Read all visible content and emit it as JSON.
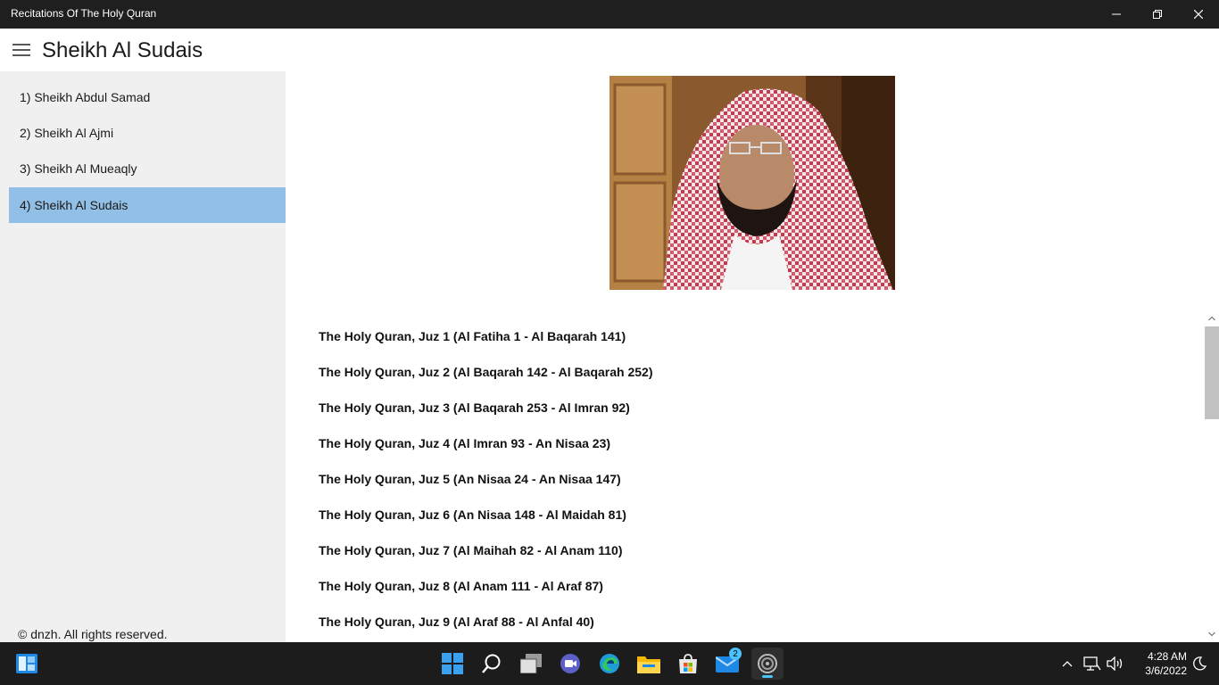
{
  "window": {
    "title": "Recitations Of The Holy Quran"
  },
  "header": {
    "page_title": "Sheikh Al Sudais"
  },
  "sidebar": {
    "items": [
      {
        "label": "1) Sheikh Abdul Samad"
      },
      {
        "label": "2) Sheikh Al Ajmi"
      },
      {
        "label": "3) Sheikh Al Mueaqly"
      },
      {
        "label": "4) Sheikh Al Sudais",
        "selected": true
      }
    ],
    "copyright": "© dnzh. All rights reserved."
  },
  "main": {
    "juz_items": [
      "The Holy Quran, Juz 1 (Al Fatiha 1 - Al Baqarah 141)",
      "The Holy Quran, Juz 2 (Al Baqarah 142 - Al Baqarah 252)",
      "The Holy Quran, Juz 3 (Al Baqarah 253 - Al Imran 92)",
      "The Holy Quran, Juz 4 (Al Imran 93 - An Nisaa 23)",
      "The Holy Quran, Juz 5 (An Nisaa 24 - An Nisaa 147)",
      "The Holy Quran, Juz 6 (An Nisaa 148 - Al Maidah 81)",
      "The Holy Quran, Juz 7 (Al Maihah 82 - Al Anam 110)",
      "The Holy Quran, Juz 8 (Al Anam 111 - Al Araf 87)",
      "The Holy Quran, Juz 9 (Al Araf 88 - Al Anfal 40)"
    ]
  },
  "taskbar": {
    "mail_badge": "2",
    "time": "4:28 AM",
    "date": "3/6/2022"
  },
  "colors": {
    "selected_nav": "#91bfe6",
    "sidebar_bg": "#f0f0f0",
    "titlebar_bg": "#1f1f1f",
    "taskbar_bg": "#1c1c1c",
    "accent": "#4cc2ff"
  }
}
